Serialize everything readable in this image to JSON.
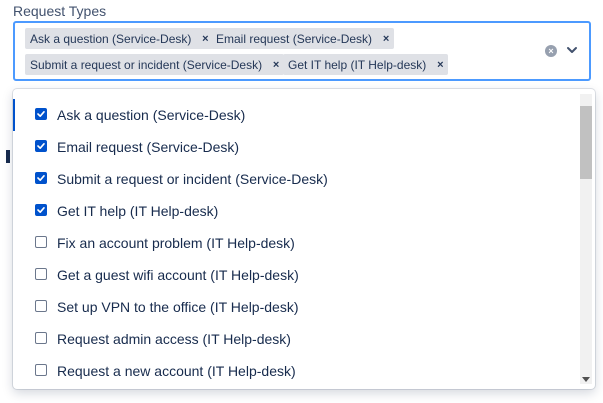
{
  "field": {
    "label": "Request Types"
  },
  "selected_chips": [
    {
      "label": "Ask a question (Service-Desk)",
      "remove": "×"
    },
    {
      "label": "Email request (Service-Desk)",
      "remove": "×"
    },
    {
      "label": "Submit a request or incident (Service-Desk)",
      "remove": "×"
    },
    {
      "label": "Get IT help (IT Help-desk)",
      "remove": "×"
    }
  ],
  "controls": {
    "clear_icon": "×",
    "chevron_icon": "chevron-down-icon"
  },
  "menu": {
    "options": [
      {
        "label": "Ask a question (Service-Desk)",
        "checked": true
      },
      {
        "label": "Email request (Service-Desk)",
        "checked": true
      },
      {
        "label": "Submit a request or incident (Service-Desk)",
        "checked": true
      },
      {
        "label": "Get IT help (IT Help-desk)",
        "checked": true
      },
      {
        "label": "Fix an account problem (IT Help-desk)",
        "checked": false
      },
      {
        "label": "Get a guest wifi account (IT Help-desk)",
        "checked": false
      },
      {
        "label": "Set up VPN to the office (IT Help-desk)",
        "checked": false
      },
      {
        "label": "Request admin access (IT Help-desk)",
        "checked": false
      },
      {
        "label": "Request a new account (IT Help-desk)",
        "checked": false
      }
    ]
  },
  "colors": {
    "accent": "#0052cc",
    "focus_border": "#4c9aff",
    "chip_bg": "#dfe1e6"
  }
}
